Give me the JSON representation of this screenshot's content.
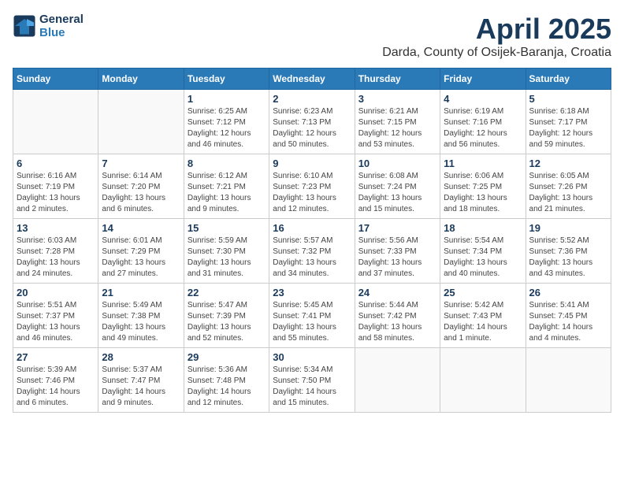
{
  "logo": {
    "line1": "General",
    "line2": "Blue"
  },
  "title": "April 2025",
  "subtitle": "Darda, County of Osijek-Baranja, Croatia",
  "header": {
    "accent_color": "#2a7ab8"
  },
  "weekdays": [
    "Sunday",
    "Monday",
    "Tuesday",
    "Wednesday",
    "Thursday",
    "Friday",
    "Saturday"
  ],
  "weeks": [
    [
      {
        "day": "",
        "info": ""
      },
      {
        "day": "",
        "info": ""
      },
      {
        "day": "1",
        "info": "Sunrise: 6:25 AM\nSunset: 7:12 PM\nDaylight: 12 hours and 46 minutes."
      },
      {
        "day": "2",
        "info": "Sunrise: 6:23 AM\nSunset: 7:13 PM\nDaylight: 12 hours and 50 minutes."
      },
      {
        "day": "3",
        "info": "Sunrise: 6:21 AM\nSunset: 7:15 PM\nDaylight: 12 hours and 53 minutes."
      },
      {
        "day": "4",
        "info": "Sunrise: 6:19 AM\nSunset: 7:16 PM\nDaylight: 12 hours and 56 minutes."
      },
      {
        "day": "5",
        "info": "Sunrise: 6:18 AM\nSunset: 7:17 PM\nDaylight: 12 hours and 59 minutes."
      }
    ],
    [
      {
        "day": "6",
        "info": "Sunrise: 6:16 AM\nSunset: 7:19 PM\nDaylight: 13 hours and 2 minutes."
      },
      {
        "day": "7",
        "info": "Sunrise: 6:14 AM\nSunset: 7:20 PM\nDaylight: 13 hours and 6 minutes."
      },
      {
        "day": "8",
        "info": "Sunrise: 6:12 AM\nSunset: 7:21 PM\nDaylight: 13 hours and 9 minutes."
      },
      {
        "day": "9",
        "info": "Sunrise: 6:10 AM\nSunset: 7:23 PM\nDaylight: 13 hours and 12 minutes."
      },
      {
        "day": "10",
        "info": "Sunrise: 6:08 AM\nSunset: 7:24 PM\nDaylight: 13 hours and 15 minutes."
      },
      {
        "day": "11",
        "info": "Sunrise: 6:06 AM\nSunset: 7:25 PM\nDaylight: 13 hours and 18 minutes."
      },
      {
        "day": "12",
        "info": "Sunrise: 6:05 AM\nSunset: 7:26 PM\nDaylight: 13 hours and 21 minutes."
      }
    ],
    [
      {
        "day": "13",
        "info": "Sunrise: 6:03 AM\nSunset: 7:28 PM\nDaylight: 13 hours and 24 minutes."
      },
      {
        "day": "14",
        "info": "Sunrise: 6:01 AM\nSunset: 7:29 PM\nDaylight: 13 hours and 27 minutes."
      },
      {
        "day": "15",
        "info": "Sunrise: 5:59 AM\nSunset: 7:30 PM\nDaylight: 13 hours and 31 minutes."
      },
      {
        "day": "16",
        "info": "Sunrise: 5:57 AM\nSunset: 7:32 PM\nDaylight: 13 hours and 34 minutes."
      },
      {
        "day": "17",
        "info": "Sunrise: 5:56 AM\nSunset: 7:33 PM\nDaylight: 13 hours and 37 minutes."
      },
      {
        "day": "18",
        "info": "Sunrise: 5:54 AM\nSunset: 7:34 PM\nDaylight: 13 hours and 40 minutes."
      },
      {
        "day": "19",
        "info": "Sunrise: 5:52 AM\nSunset: 7:36 PM\nDaylight: 13 hours and 43 minutes."
      }
    ],
    [
      {
        "day": "20",
        "info": "Sunrise: 5:51 AM\nSunset: 7:37 PM\nDaylight: 13 hours and 46 minutes."
      },
      {
        "day": "21",
        "info": "Sunrise: 5:49 AM\nSunset: 7:38 PM\nDaylight: 13 hours and 49 minutes."
      },
      {
        "day": "22",
        "info": "Sunrise: 5:47 AM\nSunset: 7:39 PM\nDaylight: 13 hours and 52 minutes."
      },
      {
        "day": "23",
        "info": "Sunrise: 5:45 AM\nSunset: 7:41 PM\nDaylight: 13 hours and 55 minutes."
      },
      {
        "day": "24",
        "info": "Sunrise: 5:44 AM\nSunset: 7:42 PM\nDaylight: 13 hours and 58 minutes."
      },
      {
        "day": "25",
        "info": "Sunrise: 5:42 AM\nSunset: 7:43 PM\nDaylight: 14 hours and 1 minute."
      },
      {
        "day": "26",
        "info": "Sunrise: 5:41 AM\nSunset: 7:45 PM\nDaylight: 14 hours and 4 minutes."
      }
    ],
    [
      {
        "day": "27",
        "info": "Sunrise: 5:39 AM\nSunset: 7:46 PM\nDaylight: 14 hours and 6 minutes."
      },
      {
        "day": "28",
        "info": "Sunrise: 5:37 AM\nSunset: 7:47 PM\nDaylight: 14 hours and 9 minutes."
      },
      {
        "day": "29",
        "info": "Sunrise: 5:36 AM\nSunset: 7:48 PM\nDaylight: 14 hours and 12 minutes."
      },
      {
        "day": "30",
        "info": "Sunrise: 5:34 AM\nSunset: 7:50 PM\nDaylight: 14 hours and 15 minutes."
      },
      {
        "day": "",
        "info": ""
      },
      {
        "day": "",
        "info": ""
      },
      {
        "day": "",
        "info": ""
      }
    ]
  ]
}
